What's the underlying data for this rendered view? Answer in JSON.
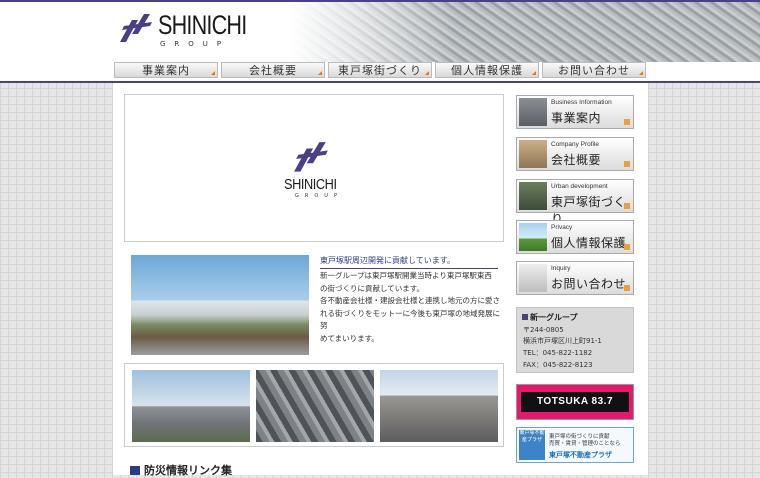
{
  "header": {
    "logo_text": "SHINICHI",
    "logo_sub": "GROUP",
    "colors": {
      "accent": "#4b3f86",
      "orange": "#e07a10"
    }
  },
  "nav": {
    "items": [
      {
        "label": "事業案内"
      },
      {
        "label": "会社概要"
      },
      {
        "label": "東戸塚街づくり"
      },
      {
        "label": "個人情報保護"
      },
      {
        "label": "お問い合わせ"
      }
    ]
  },
  "hero": {
    "logo_text": "SHINICHI",
    "logo_sub": "GROUP"
  },
  "intro": {
    "title": "東戸塚駅周辺開発に貢献しています。",
    "lines": [
      "新一グループは東戸塚駅開業当時より東戸塚駅東西",
      "の街づくりに貢献しています。",
      "各不動産会社様・建設会社様と連携し地元の方に愛さ",
      "れる街づくりをモットーに今後も東戸塚の地域発展に努",
      "めてまいります。"
    ]
  },
  "bosai": {
    "label": "防災情報リンク集"
  },
  "sidebar": {
    "items": [
      {
        "en": "Business Information",
        "ja": "事業案内"
      },
      {
        "en": "Company Profile",
        "ja": "会社概要"
      },
      {
        "en": "Urban development",
        "ja": "東戸塚街づくり"
      },
      {
        "en": "Privacy",
        "ja": "個人情報保護"
      },
      {
        "en": "Inquiry",
        "ja": "お問い合わせ"
      }
    ],
    "company": {
      "name": "新一グループ",
      "postal": "〒244-0805",
      "address": "横浜市戸塚区川上町91-1",
      "tel": "TEL：045-822-1182",
      "fax": "FAX：045-822-8123"
    },
    "banner_radio": {
      "text": "TOTSUKA 83.7"
    },
    "banner_plaza": {
      "icon_text": "東戸塚不動産プラザ",
      "line1": "東戸塚の街づくりに貢献",
      "line2": "売買・賃貸・管理のことなら",
      "line3": "東戸塚不動産プラザ"
    }
  }
}
